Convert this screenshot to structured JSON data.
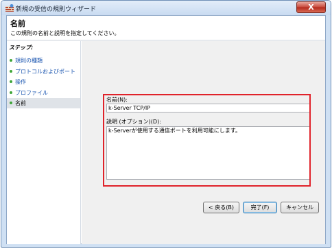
{
  "window": {
    "title": "新規の受信の規則ウィザード",
    "close_label": "X"
  },
  "header": {
    "title": "名前",
    "description": "この規則の名前と説明を指定してください。"
  },
  "steps": {
    "title": "ステップ:",
    "items": [
      {
        "label": "規則の種類"
      },
      {
        "label": "プロトコルおよびポート"
      },
      {
        "label": "操作"
      },
      {
        "label": "プロファイル"
      },
      {
        "label": "名前"
      }
    ]
  },
  "form": {
    "name_label": "名前(N):",
    "name_value": "k-Server TCP/IP",
    "description_label": "説明 (オプション)(D):",
    "description_value": "k-Serverが使用する通信ポートを利用可能にします。"
  },
  "buttons": {
    "back": "< 戻る(B)",
    "finish": "完了(F)",
    "cancel": "キャンセル"
  },
  "colors": {
    "highlight": "#e0222a",
    "step_link": "#1a55b0",
    "bullet": "#3fa639"
  }
}
